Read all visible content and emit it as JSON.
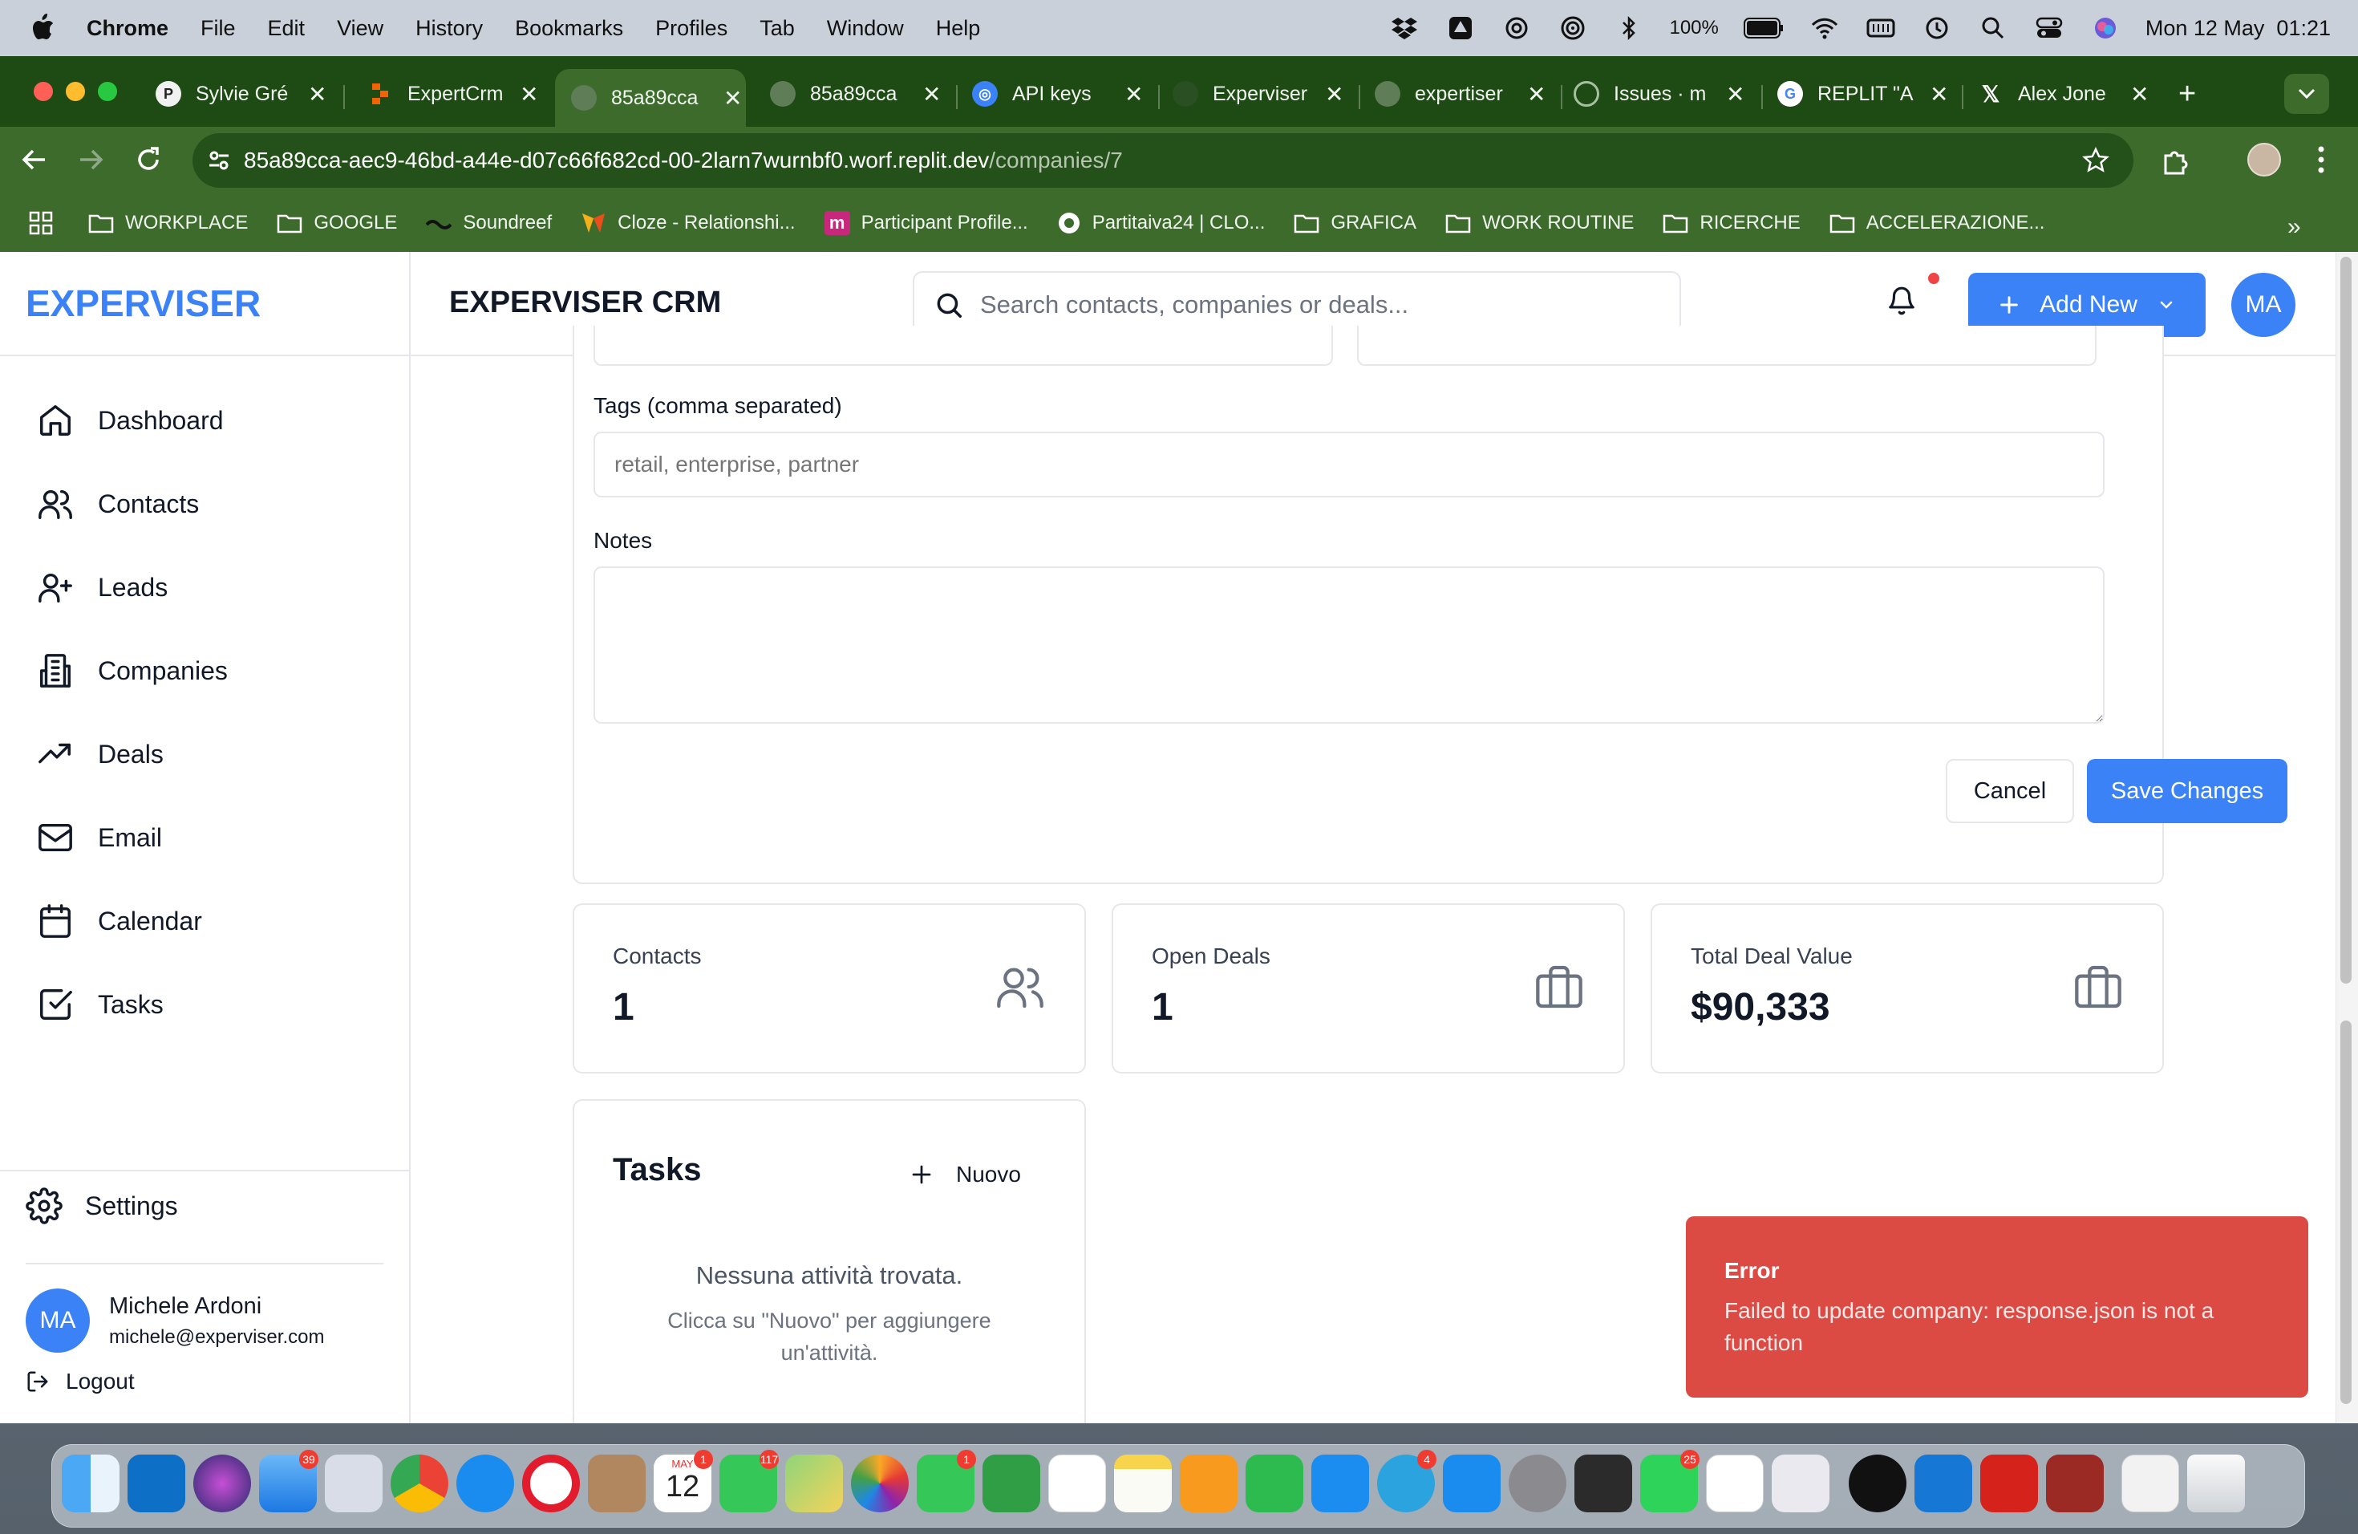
{
  "menubar": {
    "app": "Chrome",
    "items": [
      "File",
      "Edit",
      "View",
      "History",
      "Bookmarks",
      "Profiles",
      "Tab",
      "Window",
      "Help"
    ],
    "battery": "100%",
    "datetime": "Mon 12 May  01:21"
  },
  "tabs": [
    {
      "title": "Sylvie Gré",
      "icon": "pinterest-icon"
    },
    {
      "title": "ExpertCrm",
      "icon": "replit-icon"
    },
    {
      "title": "85a89cca",
      "icon": "globe-icon",
      "active": true
    },
    {
      "title": "85a89cca",
      "icon": "globe-icon"
    },
    {
      "title": "API keys",
      "icon": "openai-icon"
    },
    {
      "title": "Experviser",
      "icon": "github-icon"
    },
    {
      "title": "expertiser",
      "icon": "globe-icon"
    },
    {
      "title": "Issues · m",
      "icon": "loading-icon"
    },
    {
      "title": "REPLIT \"A",
      "icon": "google-icon"
    },
    {
      "title": "Alex Jone",
      "icon": "x-icon"
    }
  ],
  "address": {
    "host": "85a89cca-aec9-46bd-a44e-d07c66f682cd-00-2larn7wurnbf0.worf.replit.dev",
    "path": "/companies/7"
  },
  "bookmarks": [
    "WORKPLACE",
    "GOOGLE",
    "Soundreef",
    "Cloze - Relationshi...",
    "Participant Profile...",
    "Partitaiva24 | CLO...",
    "GRAFICA",
    "WORK ROUTINE",
    "RICERCHE",
    "ACCELERAZIONE..."
  ],
  "sidebar": {
    "brand": "EXPERVISER",
    "items": [
      "Dashboard",
      "Contacts",
      "Leads",
      "Companies",
      "Deals",
      "Email",
      "Calendar",
      "Tasks"
    ],
    "settings": "Settings",
    "user": {
      "initials": "MA",
      "name": "Michele Ardoni",
      "email": "michele@experviser.com"
    },
    "logout": "Logout"
  },
  "header": {
    "title": "EXPERVISER CRM",
    "search_placeholder": "Search contacts, companies or deals...",
    "add_new": "Add New",
    "avatar": "MA"
  },
  "form": {
    "tags_label": "Tags (comma separated)",
    "tags_placeholder": "retail, enterprise, partner",
    "notes_label": "Notes",
    "notes_value": "",
    "cancel": "Cancel",
    "save": "Save Changes"
  },
  "stats": [
    {
      "label": "Contacts",
      "value": "1",
      "icon": "users-icon"
    },
    {
      "label": "Open Deals",
      "value": "1",
      "icon": "briefcase-icon"
    },
    {
      "label": "Total Deal Value",
      "value": "$90,333",
      "icon": "briefcase-icon"
    }
  ],
  "tasks": {
    "title": "Tasks",
    "new": "Nuovo",
    "empty_title": "Nessuna attività trovata.",
    "empty_hint": "Clicca su \"Nuovo\" per aggiungere un'attività."
  },
  "toast": {
    "title": "Error",
    "message": "Failed to update company: response.json is not a function"
  },
  "dock": {
    "badges": {
      "mail": "39",
      "calendar": "1",
      "messages": "117",
      "facetime": "1",
      "telegram": "4",
      "whatsapp": "25"
    },
    "calendar_month": "MAY",
    "calendar_day": "12"
  },
  "colors": {
    "accent": "#3b82f6",
    "error": "#dc4a44",
    "chrome": "#3d6b2c"
  }
}
